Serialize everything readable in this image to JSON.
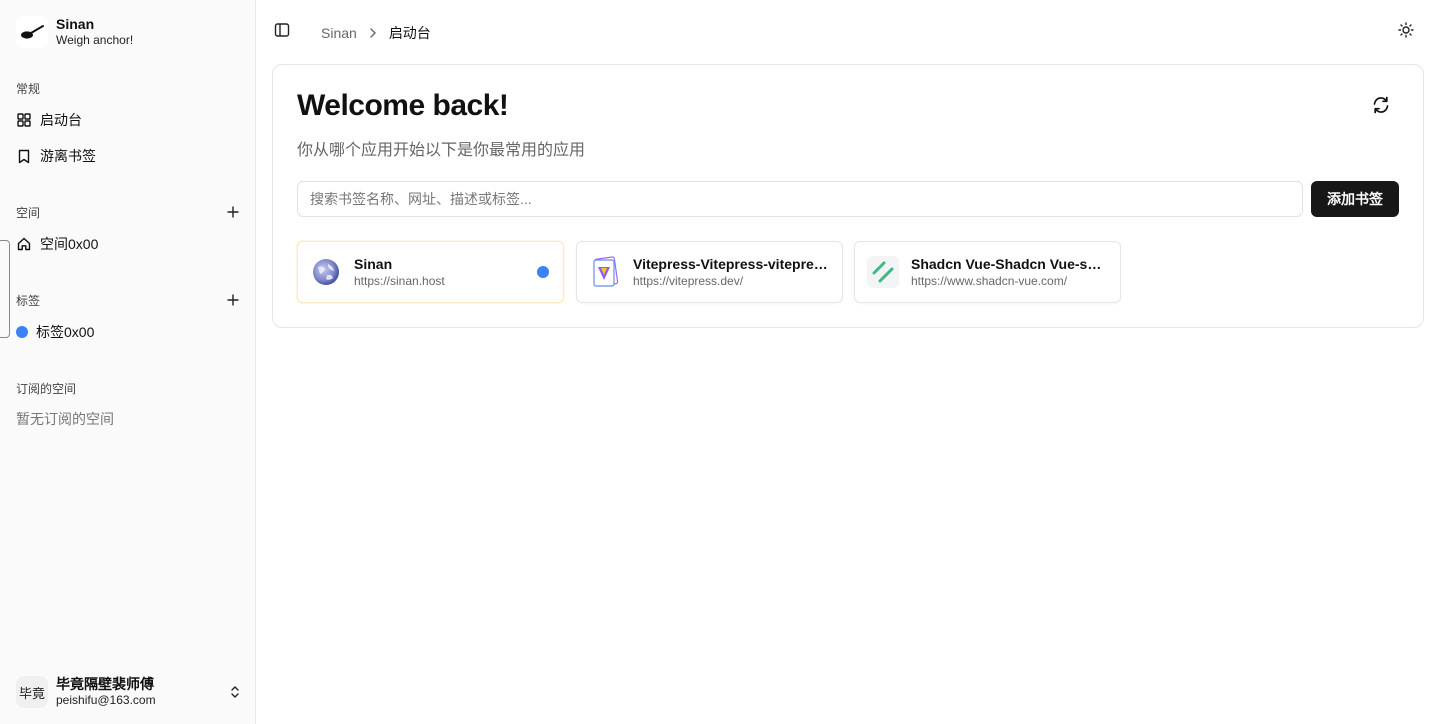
{
  "brand": {
    "name": "Sinan",
    "tagline": "Weigh anchor!"
  },
  "sidebar": {
    "general_label": "常规",
    "general_items": [
      {
        "label": "启动台",
        "icon": "grid-icon"
      },
      {
        "label": "游离书签",
        "icon": "bookmark-icon"
      }
    ],
    "spaces_label": "空间",
    "spaces": [
      {
        "label": "空间0x00",
        "icon": "home-icon"
      }
    ],
    "tags_label": "标签",
    "tags": [
      {
        "label": "标签0x00",
        "color": "#3b82f6"
      }
    ],
    "subscribed_label": "订阅的空间",
    "subscribed_empty": "暂无订阅的空间"
  },
  "user": {
    "avatar_text": "毕竟",
    "name": "毕竟隔壁裴师傅",
    "email": "peishifu@163.com"
  },
  "header": {
    "breadcrumb": [
      "Sinan",
      "启动台"
    ]
  },
  "main": {
    "title": "Welcome back!",
    "subtitle": "你从哪个应用开始以下是你最常用的应用",
    "search_placeholder": "搜索书签名称、网址、描述或标签...",
    "search_value": "",
    "add_button": "添加书签",
    "bookmarks": [
      {
        "title": "Sinan",
        "url": "https://sinan.host",
        "icon": "globe-icon",
        "tag_color": "#3b82f6"
      },
      {
        "title": "Vitepress-Vitepress-vitepress.dev",
        "url": "https://vitepress.dev/",
        "icon": "vitepress-logo-icon"
      },
      {
        "title": "Shadcn Vue-Shadcn Vue-shadcn-vue.com",
        "url": "https://www.shadcn-vue.com/",
        "icon": "shadcn-logo-icon"
      }
    ]
  },
  "colors": {
    "accent": "#171717",
    "tag_blue": "#3b82f6",
    "sidebar_bg": "#fafafa"
  }
}
